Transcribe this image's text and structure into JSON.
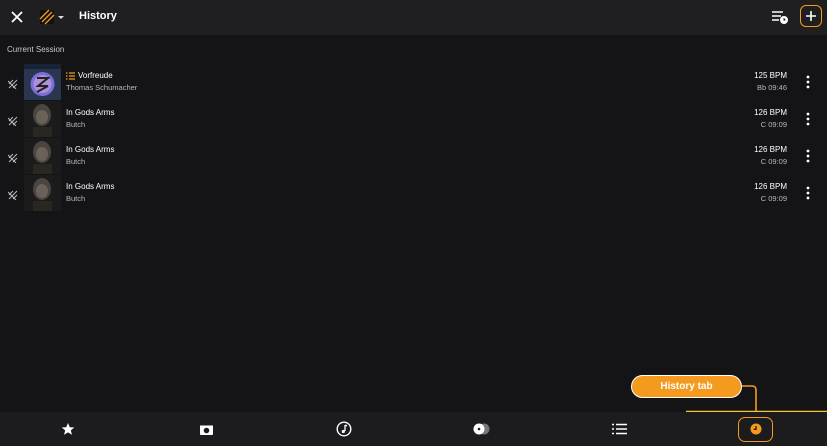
{
  "header": {
    "title": "History",
    "close_icon": "close-icon",
    "source_icon": "stripes-logo-icon",
    "queue_icon": "queue-clock-icon",
    "add_icon": "plus-icon"
  },
  "section": {
    "label": "Current Session"
  },
  "tracks": [
    {
      "title": "Vorfreude",
      "artist": "Thomas Schumacher",
      "bpm": "125 BPM",
      "key_time": "Bb  09:46",
      "has_list_icon": true
    },
    {
      "title": "In Gods Arms",
      "artist": "Butch",
      "bpm": "126 BPM",
      "key_time": "C  09:09",
      "has_list_icon": false
    },
    {
      "title": "In Gods Arms",
      "artist": "Butch",
      "bpm": "126 BPM",
      "key_time": "C  09:09",
      "has_list_icon": false
    },
    {
      "title": "In Gods Arms",
      "artist": "Butch",
      "bpm": "126 BPM",
      "key_time": "C  09:09",
      "has_list_icon": false
    }
  ],
  "callout": {
    "label": "History tab"
  },
  "tabs": [
    {
      "icon": "star-icon"
    },
    {
      "icon": "inbox-icon"
    },
    {
      "icon": "music-note-icon"
    },
    {
      "icon": "vinyl-icon"
    },
    {
      "icon": "list-icon"
    },
    {
      "icon": "history-clock-icon"
    }
  ],
  "colors": {
    "accent": "#f39a1f",
    "background": "#141416",
    "bar": "#1f1f21",
    "text_secondary": "#b8b8b8"
  }
}
